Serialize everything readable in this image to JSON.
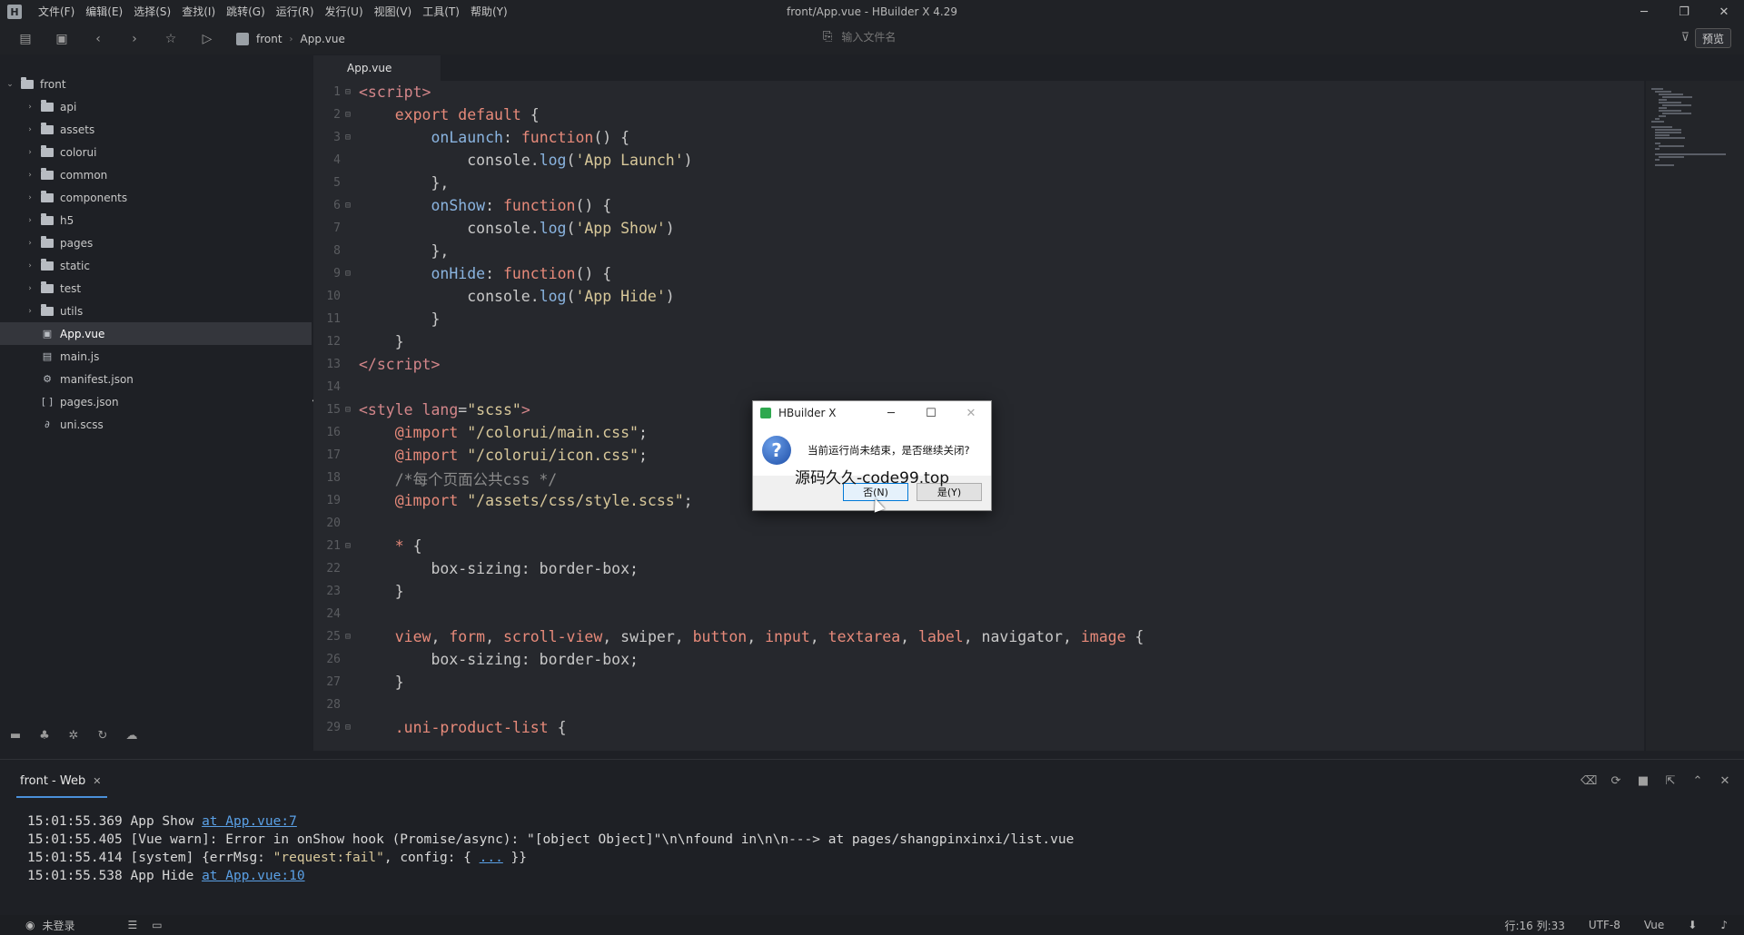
{
  "window": {
    "title": "front/App.vue - HBuilder X 4.29",
    "menu": [
      "文件(F)",
      "编辑(E)",
      "选择(S)",
      "查找(I)",
      "跳转(G)",
      "运行(R)",
      "发行(U)",
      "视图(V)",
      "工具(T)",
      "帮助(Y)"
    ],
    "controls": {
      "minimize": "─",
      "restore": "❐",
      "close": "✕"
    }
  },
  "toolbar": {
    "breadcrumb": [
      "front",
      "App.vue"
    ],
    "file_search_placeholder": "输入文件名",
    "preview_label": "预览"
  },
  "sidebar": {
    "root": "front",
    "folders": [
      "api",
      "assets",
      "colorui",
      "common",
      "components",
      "h5",
      "pages",
      "static",
      "test",
      "utils"
    ],
    "files": [
      {
        "name": "App.vue",
        "icon": "vue-file-icon",
        "glyph": "▣",
        "selected": true
      },
      {
        "name": "main.js",
        "icon": "js-file-icon",
        "glyph": "▤",
        "selected": false
      },
      {
        "name": "manifest.json",
        "icon": "manifest-file-icon",
        "glyph": "⚙",
        "selected": false
      },
      {
        "name": "pages.json",
        "icon": "json-file-icon",
        "glyph": "[ ]",
        "selected": false
      },
      {
        "name": "uni.scss",
        "icon": "scss-file-icon",
        "glyph": "∂",
        "selected": false
      }
    ]
  },
  "editor": {
    "active_tab": "App.vue",
    "lines": [
      {
        "n": "1",
        "fold": true,
        "html": "<span class=\"c-tag\">&lt;script&gt;</span>"
      },
      {
        "n": "2",
        "fold": true,
        "html": "    <span class=\"c-kw\">export default</span> {"
      },
      {
        "n": "3",
        "fold": true,
        "html": "        <span class=\"c-prop\">onLaunch</span>: <span class=\"c-kw\">function</span>() {"
      },
      {
        "n": "4",
        "fold": false,
        "html": "            console.<span class=\"c-fn\">log</span>(<span class=\"c-str\">'App Launch'</span>)"
      },
      {
        "n": "5",
        "fold": false,
        "html": "        },"
      },
      {
        "n": "6",
        "fold": true,
        "html": "        <span class=\"c-prop\">onShow</span>: <span class=\"c-kw\">function</span>() {"
      },
      {
        "n": "7",
        "fold": false,
        "html": "            console.<span class=\"c-fn\">log</span>(<span class=\"c-str\">'App Show'</span>)"
      },
      {
        "n": "8",
        "fold": false,
        "html": "        },"
      },
      {
        "n": "9",
        "fold": true,
        "html": "        <span class=\"c-prop\">onHide</span>: <span class=\"c-kw\">function</span>() {"
      },
      {
        "n": "10",
        "fold": false,
        "html": "            console.<span class=\"c-fn\">log</span>(<span class=\"c-str\">'App Hide'</span>)"
      },
      {
        "n": "11",
        "fold": false,
        "html": "        }"
      },
      {
        "n": "12",
        "fold": false,
        "html": "    }"
      },
      {
        "n": "13",
        "fold": false,
        "html": "<span class=\"c-tag\">&lt;/script&gt;</span>"
      },
      {
        "n": "14",
        "fold": false,
        "html": ""
      },
      {
        "n": "15",
        "fold": true,
        "html": "<span class=\"c-tag\">&lt;style</span> <span class=\"c-attr\">lang</span>=<span class=\"c-str\">\"scss\"</span><span class=\"c-tag\">&gt;</span>"
      },
      {
        "n": "16",
        "fold": false,
        "html": "    <span class=\"c-kw\">@import</span> <span class=\"c-str\">\"/colorui/main.css\"</span>;"
      },
      {
        "n": "17",
        "fold": false,
        "html": "    <span class=\"c-kw\">@import</span> <span class=\"c-str\">\"/colorui/icon.css\"</span>;"
      },
      {
        "n": "18",
        "fold": false,
        "html": "    <span class=\"c-com\">/*每个页面公共css */</span>"
      },
      {
        "n": "19",
        "fold": false,
        "html": "    <span class=\"c-kw\">@import</span> <span class=\"c-str\">\"/assets/css/style.scss\"</span>;"
      },
      {
        "n": "20",
        "fold": false,
        "html": ""
      },
      {
        "n": "21",
        "fold": true,
        "html": "    <span class=\"c-sel\">*</span> {"
      },
      {
        "n": "22",
        "fold": false,
        "html": "        box-sizing: border-box;"
      },
      {
        "n": "23",
        "fold": false,
        "html": "    }"
      },
      {
        "n": "24",
        "fold": false,
        "html": ""
      },
      {
        "n": "25",
        "fold": true,
        "html": "    <span class=\"c-sel\">view</span>, <span class=\"c-sel\">form</span>, <span class=\"c-sel\">scroll-view</span>, swiper, <span class=\"c-sel\">button</span>, <span class=\"c-sel\">input</span>, <span class=\"c-sel\">textarea</span>, <span class=\"c-sel\">label</span>, navigator, <span class=\"c-sel\">image</span> {"
      },
      {
        "n": "26",
        "fold": false,
        "html": "        box-sizing: border-box;"
      },
      {
        "n": "27",
        "fold": false,
        "html": "    }"
      },
      {
        "n": "28",
        "fold": false,
        "html": ""
      },
      {
        "n": "29",
        "fold": true,
        "html": "    <span class=\"c-sel\">.uni-product-list</span> {"
      }
    ]
  },
  "console": {
    "tab_label": "front - Web",
    "logs": [
      {
        "time": "15:01:55.369",
        "text": "App Show ",
        "link": "at App.vue:7"
      },
      {
        "time": "15:01:55.405",
        "text": "[Vue warn]: Error in onShow hook (Promise/async): \"[object Object]\"\\n\\nfound in\\n\\n---> at pages/shangpinxinxi/list.vue",
        "link": ""
      },
      {
        "time": "15:01:55.414",
        "text": "[system] {errMsg: ",
        "str": "\"request:fail\"",
        "tail": ", config: { ",
        "link": "...",
        "end": " }}"
      },
      {
        "time": "15:01:55.538",
        "text": "App Hide ",
        "link": "at App.vue:10"
      }
    ]
  },
  "statusbar": {
    "login": "未登录",
    "position": "行:16  列:33",
    "encoding": "UTF-8",
    "language": "Vue"
  },
  "dialog": {
    "title": "HBuilder X",
    "message": "当前运行尚未结束，是否继续关闭?",
    "no_button": "否(N)",
    "yes_button": "是(Y)",
    "watermark": "源码久久-code99.top"
  }
}
